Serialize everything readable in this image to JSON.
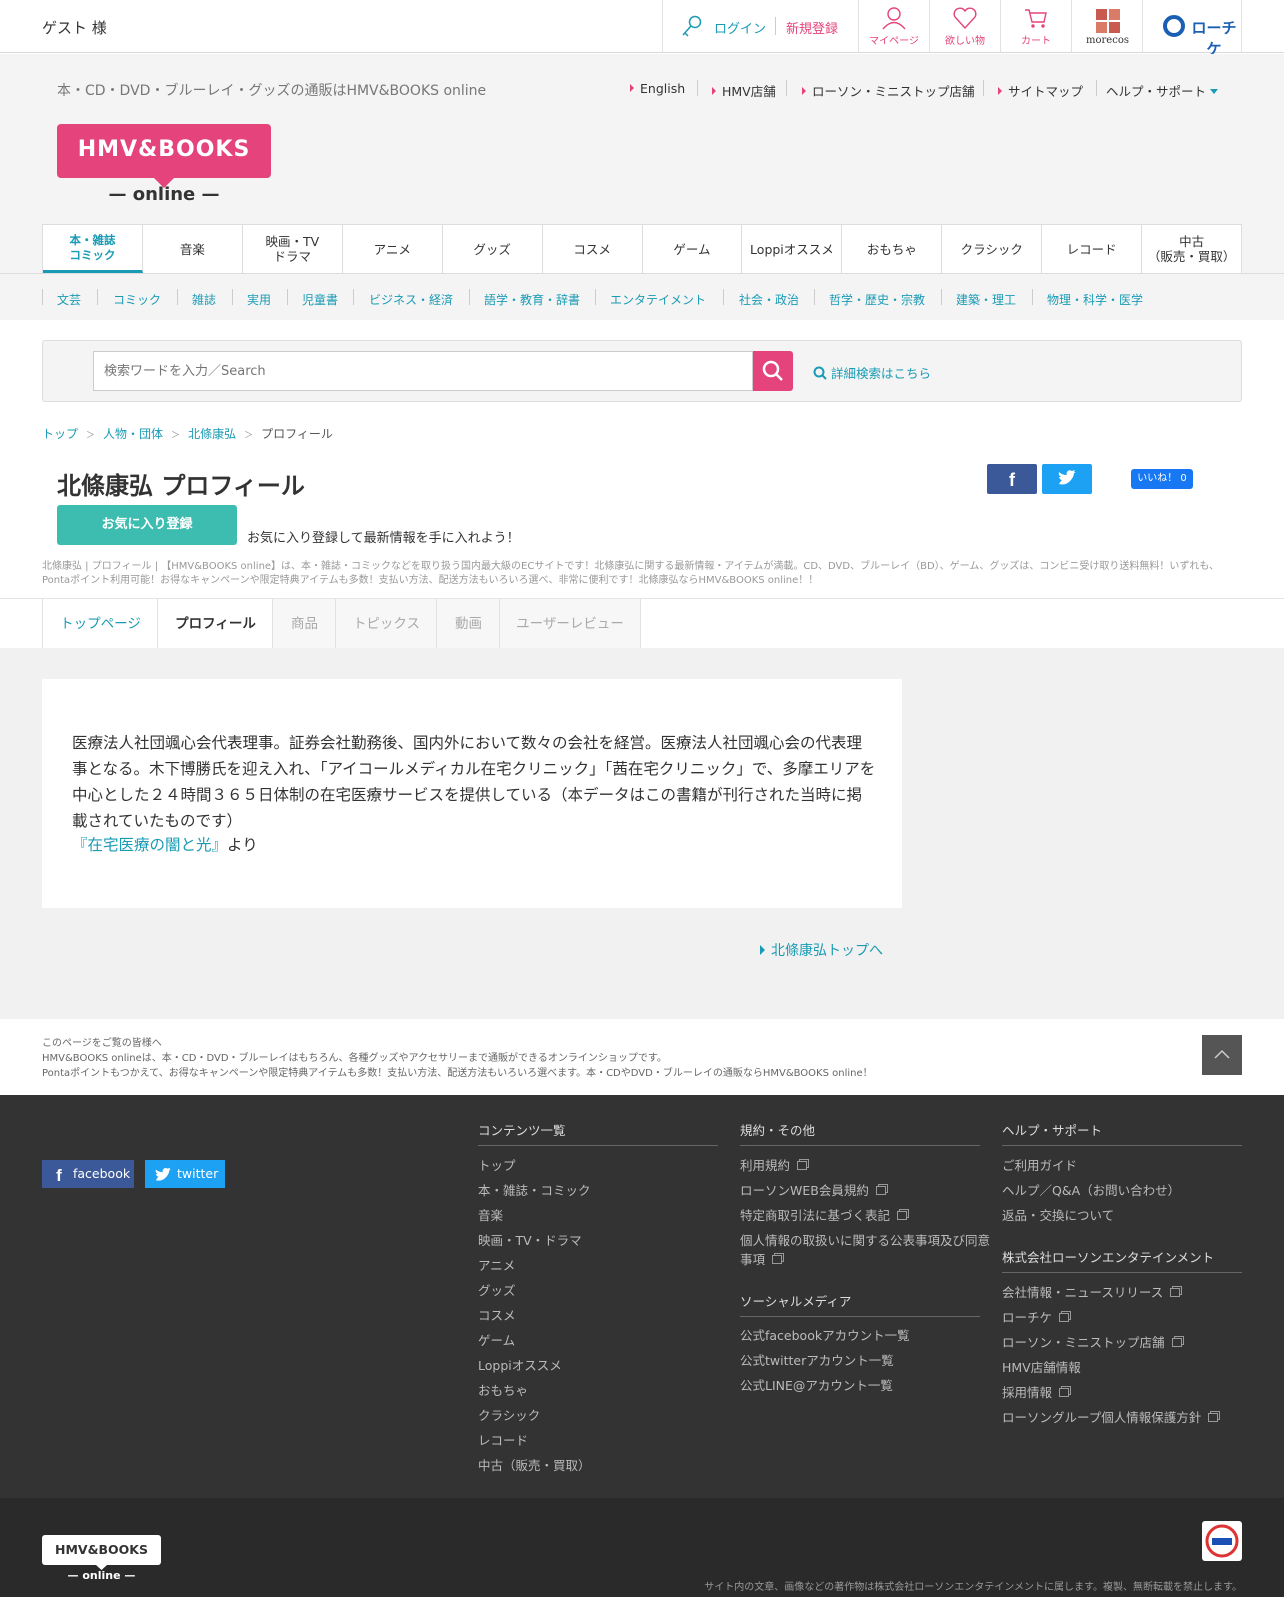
{
  "topbar": {
    "guest": "ゲスト 様",
    "login": "ログイン",
    "register": "新規登録",
    "icons": [
      {
        "name": "mypage-icon",
        "label": "マイページ"
      },
      {
        "name": "wishlist-icon",
        "label": "欲しい物"
      },
      {
        "name": "cart-icon",
        "label": "カート"
      }
    ],
    "morecos": "morecos",
    "lochike": "ローチケ"
  },
  "header": {
    "tagline": "本・CD・DVD・ブルーレイ・グッズの通販はHMV&BOOKS online",
    "links": [
      "English",
      "HMV店舗",
      "ローソン・ミニストップ店舗",
      "サイトマップ",
      "ヘルプ・サポート"
    ],
    "logo_top": "HMV&BOOKS",
    "logo_bottom": "— online —"
  },
  "mainnav": [
    "本・雑誌\nコミック",
    "音楽",
    "映画・TV\nドラマ",
    "アニメ",
    "グッズ",
    "コスメ",
    "ゲーム",
    "Loppiオススメ",
    "おもちゃ",
    "クラシック",
    "レコード",
    "中古\n（販売・買取）"
  ],
  "subnav": [
    "文芸",
    "コミック",
    "雑誌",
    "実用",
    "児童書",
    "ビジネス・経済",
    "語学・教育・辞書",
    "エンタテイメント",
    "社会・政治",
    "哲学・歴史・宗教",
    "建築・理工",
    "物理・科学・医学"
  ],
  "search": {
    "placeholder": "検索ワードを入力／Search",
    "advanced": "詳細検索はこちら"
  },
  "breadcrumb": [
    "トップ",
    "人物・団体",
    "北條康弘",
    "プロフィール"
  ],
  "page": {
    "title": "北條康弘 プロフィール",
    "like_label": "いいね！ 0",
    "fav_button": "お気に入り登録",
    "fav_text": "お気に入り登録して最新情報を手に入れよう！",
    "meta": "北條康弘 | プロフィール | 【HMV&BOOKS online】は、本・雑誌・コミックなどを取り扱う国内最大級のECサイトです！北條康弘に関する最新情報・アイテムが満載。CD、DVD、ブルーレイ（BD）、ゲーム、グッズは、コンビニ受け取り送料無料！いずれも、Pontaポイント利用可能！お得なキャンペーンや限定特典アイテムも多数！支払い方法、配送方法もいろいろ選べ、非常に便利です！北條康弘ならHMV&BOOKS online！！"
  },
  "tabs": [
    "トップページ",
    "プロフィール",
    "商品",
    "トピックス",
    "動画",
    "ユーザーレビュー"
  ],
  "bio": {
    "text": "医療法人社団颯心会代表理事。証券会社勤務後、国内外において数々の会社を経営。医療法人社団颯心会の代表理事となる。木下博勝氏を迎え入れ、「アイコールメディカル在宅クリニック」「茜在宅クリニック」で、多摩エリアを中心とした２４時間３６５日体制の在宅医療サービスを提供している（本データはこの書籍が刊行された当時に掲載されていたものです）",
    "book": "『在宅医療の闇と光』",
    "suffix": "より",
    "top_link": "北條康弘トップへ"
  },
  "prefooter": [
    "このページをご覧の皆様へ",
    "HMV&BOOKS onlineは、本・CD・DVD・ブルーレイはもちろん、各種グッズやアクセサリーまで通販ができるオンラインショップです。",
    "Pontaポイントもつかえて、お得なキャンペーンや限定特典アイテムも多数！支払い方法、配送方法もいろいろ選べます。本・CDやDVD・ブルーレイの通販ならHMV&BOOKS online！"
  ],
  "footer": {
    "facebook": "facebook",
    "twitter": "twitter",
    "contents_title": "コンテンツ一覧",
    "contents": [
      "トップ",
      "本・雑誌・コミック",
      "音楽",
      "映画・TV・ドラマ",
      "アニメ",
      "グッズ",
      "コスメ",
      "ゲーム",
      "Loppiオススメ",
      "おもちゃ",
      "クラシック",
      "レコード",
      "中古（販売・買取）"
    ],
    "terms_title": "規約・その他",
    "terms": [
      "利用規約",
      "ローソンWEB会員規約",
      "特定商取引法に基づく表記",
      "個人情報の取扱いに関する公表事項及び同意",
      "事項"
    ],
    "social_title": "ソーシャルメディア",
    "social": [
      "公式facebookアカウント一覧",
      "公式twitterアカウント一覧",
      "公式LINE@アカウント一覧"
    ],
    "help_title": "ヘルプ・サポート",
    "help": [
      "ご利用ガイド",
      "ヘルプ／Q&A（お問い合わせ）",
      "返品・交換について"
    ],
    "company_title": "株式会社ローソンエンタテインメント",
    "company": [
      "会社情報・ニュースリリース",
      "ローチケ",
      "ローソン・ミニストップ店舗",
      "HMV店舗情報",
      "採用情報",
      "ローソングループ個人情報保護方針"
    ],
    "logo_top": "HMV&BOOKS",
    "logo_bottom": "— online —",
    "rights": "サイト内の文章、画像などの著作物は株式会社ローソンエンタテインメントに属します。複製、無断転載を禁止します。"
  },
  "colors": {
    "accent": "#e4447b",
    "link": "#1a9bb5",
    "fav": "#3dbdb0",
    "footer": "#333333"
  }
}
